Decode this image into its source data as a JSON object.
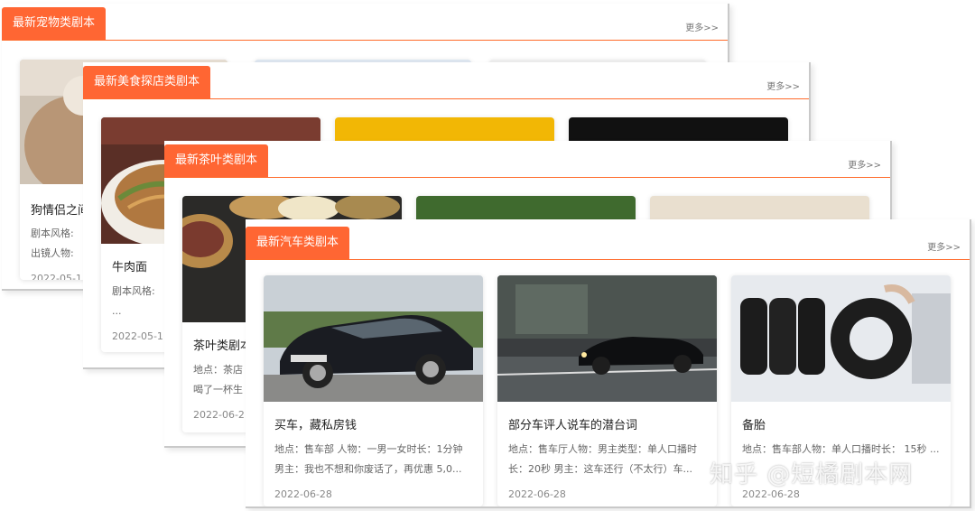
{
  "panels": [
    {
      "tag": "最新宠物类剧本",
      "more": "更多>>",
      "cards": [
        {
          "title": "狗情侣之间",
          "desc": "剧本风格:\n出镜人物:",
          "date": "2022-05-1"
        }
      ]
    },
    {
      "tag": "最新美食探店类剧本",
      "more": "更多>>",
      "cards": [
        {
          "title": "牛肉面",
          "desc": "剧本风格:\n...",
          "date": "2022-05-1"
        }
      ]
    },
    {
      "tag": "最新茶叶类剧本",
      "more": "更多>>",
      "cards": [
        {
          "title": "茶叶类剧本",
          "desc": "地点：茶店\n喝了一杯生",
          "date": "2022-06-2"
        }
      ]
    },
    {
      "tag": "最新汽车类剧本",
      "more": "更多>>",
      "cards": [
        {
          "title": "买车，藏私房钱",
          "desc": "地点：售车部 人物：一男一女时长：1分钟 男主：我也不想和你废话了，再优惠 5,0...",
          "date": "2022-06-28"
        },
        {
          "title": "部分车评人说车的潜台词",
          "desc": "地点：售车厅人物：男主类型：单人口播时长：20秒 男主：这车还行（不太行）车...",
          "date": "2022-06-28"
        },
        {
          "title": "备胎",
          "desc": "地点：售车部人物：单人口播时长： 15秒 ...",
          "date": "2022-06-28"
        }
      ]
    }
  ],
  "watermark": "知乎 @短橘剧本网"
}
